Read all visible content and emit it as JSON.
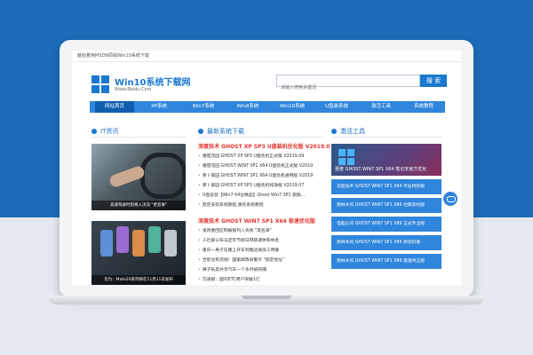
{
  "topbar": {
    "notice": "献给着用MSDN原版Win10系统下载"
  },
  "brand": {
    "name": "Win10系统下载网",
    "url": "Www.Baidu.Com",
    "accent": "#1a78cf"
  },
  "search": {
    "placeholder": "请输入搜索关键词",
    "button_label": "搜 索"
  },
  "nav": {
    "items": [
      {
        "label": "网站首页"
      },
      {
        "label": "XP系统"
      },
      {
        "label": "Win7系统"
      },
      {
        "label": "Win8系统"
      },
      {
        "label": "Win10系统"
      },
      {
        "label": "U盘装系统"
      },
      {
        "label": "激活工具"
      },
      {
        "label": "系统教程"
      }
    ]
  },
  "sections": {
    "left_title": "IT资讯",
    "mid_title": "最新系统下载",
    "right_title": "激活工具"
  },
  "left": {
    "caption1": "高速驾驶时刻将入决流 \"更恶果\"",
    "caption2": "华为：Mate20系列将在11月11日发布"
  },
  "middle": {
    "headline1": "深度技术 GHOST XP SP3 U盘装机优化版 V2019.0",
    "list1": [
      "番茄花园 GHOST XP SP3 U盘装机正式版 V2019.09",
      "番茄花园 GHOST WIN7 SP1 X64 U盘装机正式版 V2019",
      "萝卜家园 GHOST WIN7 SP1 X64 U盘装机通用版 V2019",
      "萝卜家园 GHOST XP SP3 U盘装机纯净版 V2019.07",
      "U盘安装【Win7 64位精品】Ghost Win7 SP1 旗舰...",
      "稳定安装系统教程,重装系统教程"
    ],
    "headline2": "深度技术 GHOST WIN7 SP1 X64 极速优化版",
    "list2": [
      "发改委回应制被报列入央视 \"黑名单\"",
      "人社部公布法定年节假日带薪调休和休息",
      "重庆一男子在路上开车到路边请员工用餐",
      "合影也有违规！国家邮政局警示 \"指定地址\"",
      "男子私卖共享汽车一个多月被抓捕",
      "交通部：国内ETC用户突破1亿"
    ]
  },
  "right": {
    "feature": "惠普 GHOST WIN7 SP1 X64 笔记本官方优化",
    "tiles": [
      "深度技术 GHOST WIN7 SP1 X64 专业特别版",
      "雨林木风 GHOST WIN7 SP1 X86 经典装机版",
      "电脑公司 GHOST WIN7 SP1 X86 正式专业版",
      "雨林木风 GHOST WIN7 SP1 X86 新装机版",
      "雨林木风 GHOST WIN7 SP1 X86 极速纯正版"
    ]
  }
}
